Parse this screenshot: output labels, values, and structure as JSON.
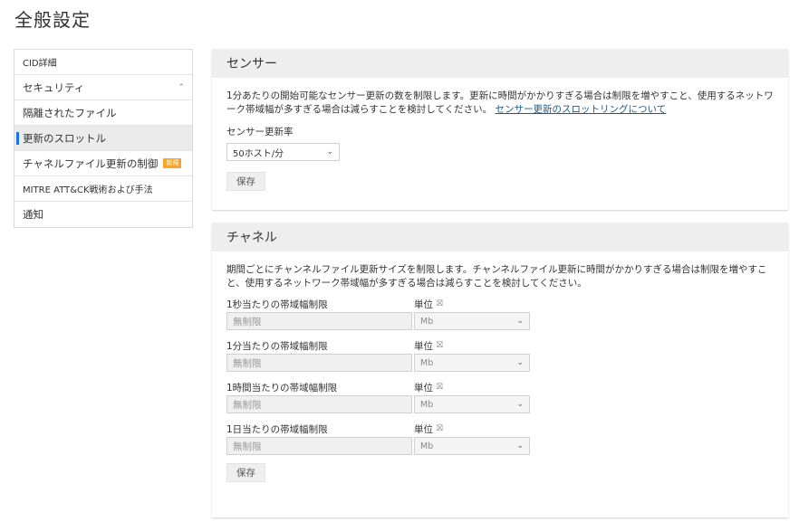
{
  "page": {
    "title": "全般設定"
  },
  "sidebar": {
    "items": [
      {
        "label": "CID詳細"
      },
      {
        "label": "セキュリティ",
        "caret": "^"
      },
      {
        "label": "隔離されたファイル"
      },
      {
        "label": "更新のスロットル",
        "active": true
      },
      {
        "label": "チャネルファイル更新の制御",
        "badge": "新規"
      },
      {
        "label": "MITRE ATT&CK戦術および手法"
      },
      {
        "label": "通知"
      }
    ]
  },
  "sensor_panel": {
    "header": "センサー",
    "description": "1分あたりの開始可能なセンサー更新の数を制限します。更新に時間がかかりすぎる場合は制限を増やすこと、使用するネットワーク帯域幅が多すぎる場合は減らすことを検討してください。",
    "link": "センサー更新のスロットリングについて",
    "rate_label": "センサー更新率",
    "rate_value": "50ホスト/分",
    "save_label": "保存"
  },
  "channel_panel": {
    "header": "チャネル",
    "description": "期間ごとにチャンネルファイル更新サイズを制限します。チャンネルファイル更新に時間がかかりすぎる場合は制限を増やすこと、使用するネットワーク帯域幅が多すぎる場合は減らすことを検討してください。",
    "unit_label": "単位",
    "rows": [
      {
        "label": "1秒当たりの帯域幅制限",
        "value": "無制限",
        "unit": "Mb"
      },
      {
        "label": "1分当たりの帯域幅制限",
        "value": "無制限",
        "unit": "Mb"
      },
      {
        "label": "1時間当たりの帯域幅制限",
        "value": "無制限",
        "unit": "Mb"
      },
      {
        "label": "1日当たりの帯域幅制限",
        "value": "無制限",
        "unit": "Mb"
      }
    ],
    "save_label": "保存"
  },
  "icons": {
    "caret": "chevron-up-icon",
    "chevron": "chevron-down-icon",
    "lock": "lock-icon"
  },
  "colors": {
    "accent": "#1a73e8",
    "badge": "#f5a623",
    "link": "#1a5a8a"
  }
}
